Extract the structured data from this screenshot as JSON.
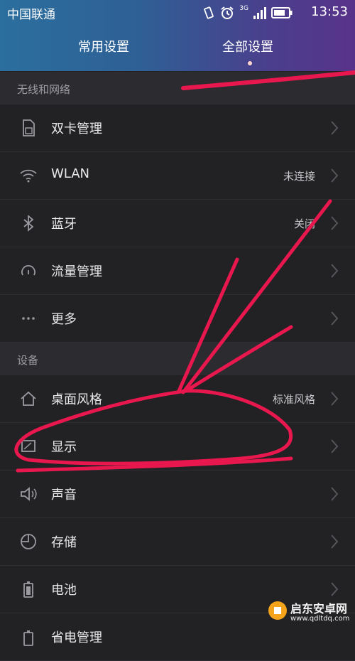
{
  "status": {
    "carrier": "中国联通",
    "network": "3G",
    "time": "13:53"
  },
  "tabs": [
    {
      "label": "常用设置"
    },
    {
      "label": "全部设置"
    }
  ],
  "sections": [
    {
      "title": "无线和网络"
    },
    {
      "title": "设备"
    }
  ],
  "rows": [
    {
      "label": "双卡管理",
      "icon": "sim-card-icon"
    },
    {
      "label": "WLAN",
      "value": "未连接",
      "icon": "wifi-icon"
    },
    {
      "label": "蓝牙",
      "value": "关闭",
      "icon": "bluetooth-icon"
    },
    {
      "label": "流量管理",
      "icon": "data-usage-icon"
    },
    {
      "label": "更多",
      "icon": "more-icon"
    },
    {
      "label": "桌面风格",
      "value": "标准风格",
      "icon": "home-icon"
    },
    {
      "label": "显示",
      "icon": "display-icon"
    },
    {
      "label": "声音",
      "icon": "sound-icon"
    },
    {
      "label": "存储",
      "icon": "storage-icon"
    },
    {
      "label": "电池",
      "icon": "battery-icon"
    },
    {
      "label": "省电管理",
      "icon": "power-saving-icon"
    }
  ],
  "watermark": {
    "title": "启东安卓网",
    "url": "www.qdltdq.com"
  },
  "colors": {
    "annotation": "#e8174e",
    "background": "#222225",
    "section": "#2c2c30"
  }
}
